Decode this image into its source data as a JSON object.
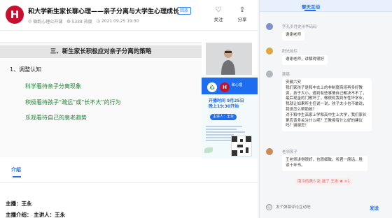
{
  "header": {
    "logo_letter": "H",
    "title": "和大学新生家长聊心理——亲子分离与大学生心理成长",
    "status_badge": "回放",
    "org_name": "微韵心理公开课",
    "views": "5338 热度",
    "date": "2021.09.25 19:30",
    "follow_label": "关注",
    "share_label": "分享"
  },
  "slide": {
    "title": "三、新生家长积极应对亲子分离的策略",
    "point": "1、调整认知",
    "line1": "科学看待亲子分离现象",
    "line2": "积极看待孩子“疏远”或“长不大”的行为",
    "line3": "乐观看待自己的衰老趋势"
  },
  "poster": {
    "logo_left": "心",
    "logo_right": "H",
    "brand": "和心理",
    "time_line1": "开播时间 9月25日",
    "time_line2": "晚上19:30开始",
    "host": "主讲人：王永"
  },
  "tabs": [
    {
      "label": "介绍"
    }
  ],
  "info": {
    "host_line": "主播：王永",
    "intro_line": "主播介绍： 主讲人：王永"
  },
  "chat": {
    "tab_label": "聊天互动",
    "messages": [
      {
        "name": "字孔岁月史卅华码码",
        "text": "谢谢老师",
        "color": "#7b93c9"
      },
      {
        "name": "阳光灿烂",
        "text": "谢谢老师，讲解得很好",
        "color": "#e0a640"
      },
      {
        "name": "慈慈",
        "text": "安徽六安\n我们家孩子是和中去上的非制度商培再多好教资，孩子大小，遇到有些事情自己都决不不了，最后现金的门歌坏了，做很则我到东性坏学业，我就让如果所主任说一说，孩子太小也不敢说，我该怎么帮助她？\n对于和中生高家上学和高中生上大学，我们家长更应该多关注什么呢？王教授有什么好的建议吗？谢谢您！",
        "color": "#b2b6bd"
      },
      {
        "name": "老邻笑子",
        "text": "王老师讲得很好，也很细致。听君一席话，胜读十年书。",
        "color": "#c98b5a"
      }
    ],
    "gift_text": "南冷的美少女 送了 王永",
    "gift_count": "×1",
    "input_placeholder": "发个弹幕评论互动吧",
    "send_label": "发送"
  }
}
